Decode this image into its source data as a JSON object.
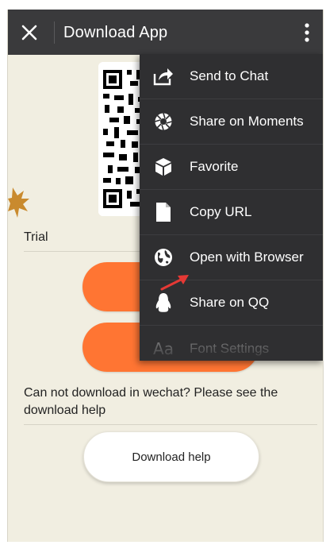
{
  "app_bar": {
    "title": "Download App",
    "close_icon": "close-icon",
    "more_icon": "more-vert-icon",
    "background": "#3a3a3c"
  },
  "page": {
    "trial_label": "Trial",
    "help_text": "Can not download in wechat?  Please see the download help",
    "help_button_label": "Download help",
    "accent_color": "#ff7533",
    "background": "#f1eee1"
  },
  "menu": {
    "items": [
      {
        "label": "Send to Chat",
        "icon": "share-icon"
      },
      {
        "label": "Share on Moments",
        "icon": "aperture-icon"
      },
      {
        "label": "Favorite",
        "icon": "cube-icon"
      },
      {
        "label": "Copy URL",
        "icon": "document-icon"
      },
      {
        "label": "Open with Browser",
        "icon": "globe-icon"
      },
      {
        "label": "Share on QQ",
        "icon": "penguin-icon"
      },
      {
        "label": "Font Settings",
        "icon": "font-icon"
      }
    ],
    "font_icon_text": "Aa",
    "background": "#2f2f31"
  },
  "annotation": {
    "arrow_color": "#e53935"
  }
}
